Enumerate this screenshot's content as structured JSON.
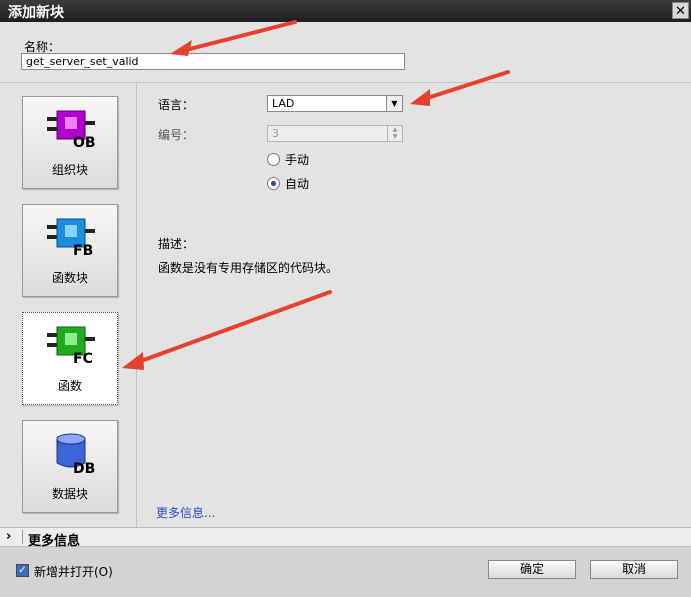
{
  "window": {
    "title": "添加新块",
    "close_glyph": "✕"
  },
  "name": {
    "label": "名称：",
    "value": "get_server_set_valid"
  },
  "blocks": [
    {
      "code": "OB",
      "label": "组织块",
      "color": "#b000d0"
    },
    {
      "code": "FB",
      "label": "函数块",
      "color": "#1a8fe0"
    },
    {
      "code": "FC",
      "label": "函数",
      "color": "#1faa1f"
    },
    {
      "code": "DB",
      "label": "数据块",
      "color": "#3c64d8"
    }
  ],
  "settings": {
    "language_label": "语言：",
    "language_value": "LAD",
    "number_label": "编号：",
    "number_value": "3",
    "radio_manual": "手动",
    "radio_auto": "自动",
    "selected_mode": "auto"
  },
  "description": {
    "label": "描述：",
    "text": "函数是没有专用存储区的代码块。"
  },
  "more_info_link": "更多信息...",
  "expander": {
    "label": "更多信息"
  },
  "footer": {
    "add_open_label": "新增并打开(O)",
    "add_open_checked": true,
    "ok_label": "确定",
    "cancel_label": "取消"
  },
  "colors": {
    "arrow": "#e8402a",
    "link": "#2a4ec0"
  }
}
